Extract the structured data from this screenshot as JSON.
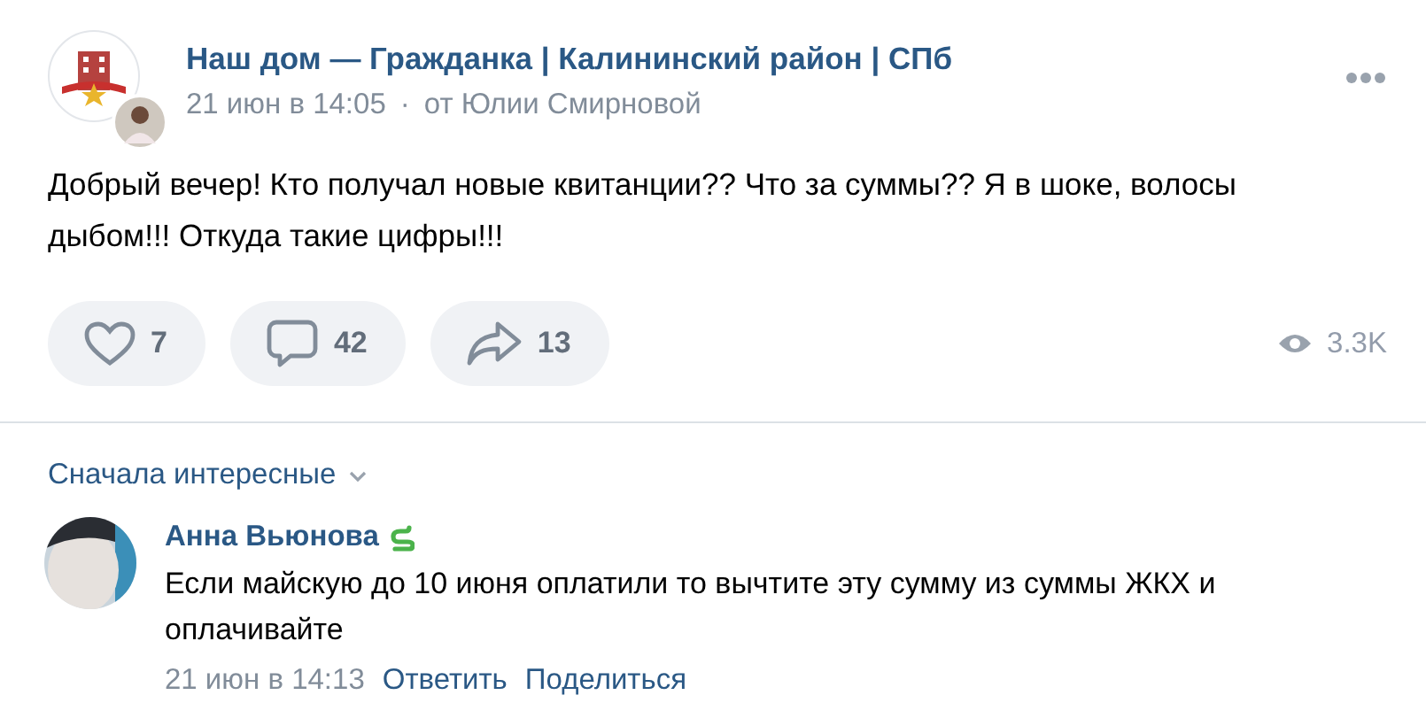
{
  "post": {
    "author": "Наш дом — Гражданка | Калининский район | СПб",
    "date": "21 июн в 14:05",
    "separator": "·",
    "signed_by": "от Юлии Смирновой",
    "text": "Добрый вечер! Кто получал новые квитанции?? Что за суммы?? Я в шоке, волосы дыбом!!! Откуда такие цифры!!!",
    "actions": [
      {
        "kind": "like",
        "count": "7"
      },
      {
        "kind": "comment",
        "count": "42"
      },
      {
        "kind": "share",
        "count": "13"
      }
    ],
    "views": "3.3K"
  },
  "comments_sort": "Сначала интересные",
  "comments": [
    {
      "author": "Анна Вьюнова",
      "badge": true,
      "text": "Если майскую до 10 июня оплатили то вычтите эту сумму из суммы ЖКХ и оплачивайте",
      "date": "21 июн в 14:13",
      "links": [
        "Ответить",
        "Поделиться"
      ]
    }
  ]
}
